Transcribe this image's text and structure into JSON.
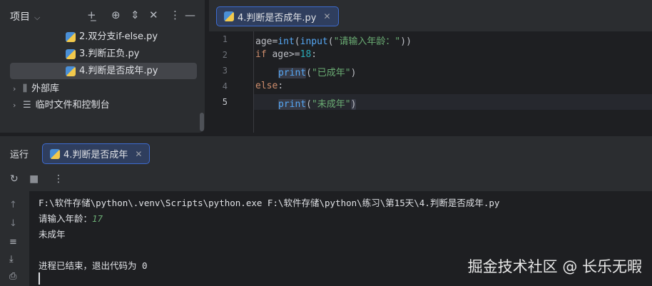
{
  "project": {
    "title": "项目",
    "files": [
      "2.双分支if-else.py",
      "3.判断正负.py",
      "4.判断是否成年.py"
    ],
    "folders": [
      "外部库",
      "临时文件和控制台"
    ]
  },
  "editor": {
    "tab_label": "4.判断是否成年.py",
    "line_numbers": [
      "1",
      "2",
      "3",
      "4",
      "5"
    ],
    "code": {
      "l1_var": "age=",
      "l1_int": "int",
      "l1_p1": "(",
      "l1_input": "input",
      "l1_p2": "(",
      "l1_str": "\"请输入年龄：\"",
      "l1_p3": "))",
      "l2_if": "if",
      "l2_rest": " age>=",
      "l2_num": "18",
      "l2_colon": ":",
      "l3_print": "print",
      "l3_p1": "(",
      "l3_str": "\"已成年\"",
      "l3_p2": ")",
      "l4_else": "else",
      "l4_colon": ":",
      "l5_print": "print",
      "l5_p1": "(",
      "l5_str": "\"未成年\"",
      "l5_p2": ")"
    }
  },
  "run": {
    "label": "运行",
    "tab_label": "4.判断是否成年",
    "console": {
      "command": "F:\\软件存储\\python\\.venv\\Scripts\\python.exe F:\\软件存储\\python\\练习\\第15天\\4.判断是否成年.py",
      "prompt": "请输入年龄：",
      "input_value": "17",
      "output": "未成年",
      "exit_message": "进程已结束，退出代码为 0"
    }
  },
  "watermark": "掘金技术社区 @ 长乐无暇",
  "colors": {
    "keyword": "#cf8e6d",
    "function": "#56a8f5",
    "string": "#6aab73",
    "number": "#2aacb8",
    "accent": "#3d6bcf"
  }
}
